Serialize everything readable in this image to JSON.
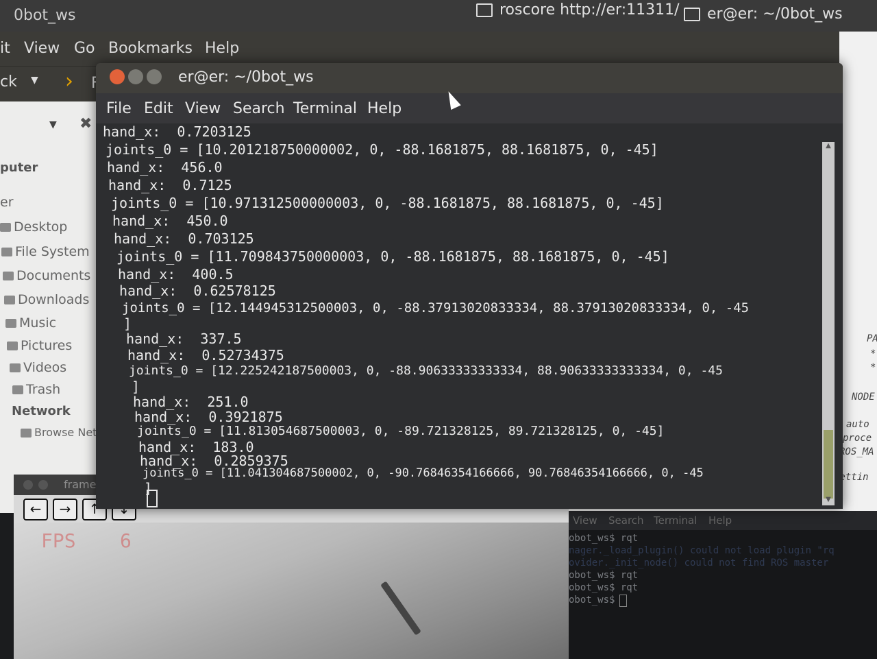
{
  "top_panel": {
    "app_title": "0bot_ws",
    "task_roscore": "roscore http://er:11311/",
    "task_terminal": "er@er: ~/0bot_ws"
  },
  "file_manager": {
    "menu": [
      "it",
      "View",
      "Go",
      "Bookmarks",
      "Help"
    ],
    "toolbar_back": "ck",
    "toolbar_f": "F",
    "sidebar_heading_computer": "puter",
    "sidebar_items": [
      {
        "label": "er",
        "icon": "home-icon"
      },
      {
        "label": "Desktop",
        "icon": "folder-icon"
      },
      {
        "label": "File System",
        "icon": "drive-icon"
      },
      {
        "label": "Documents",
        "icon": "folder-icon"
      },
      {
        "label": "Downloads",
        "icon": "folder-icon"
      },
      {
        "label": "Music",
        "icon": "music-icon"
      },
      {
        "label": "Pictures",
        "icon": "pictures-icon"
      },
      {
        "label": "Videos",
        "icon": "video-icon"
      },
      {
        "label": "Trash",
        "icon": "trash-icon"
      }
    ],
    "sidebar_heading_network": "Network",
    "sidebar_network_item": "Browse Netw..."
  },
  "terminal": {
    "title": "er@er: ~/0bot_ws",
    "menu": [
      "File",
      "Edit",
      "View",
      "Search",
      "Terminal",
      "Help"
    ],
    "lines": [
      "hand_x:  0.7203125",
      "joints_0 = [10.201218750000002, 0, -88.1681875, 88.1681875, 0, -45]",
      "hand_x:  456.0",
      "hand_x:  0.7125",
      "joints_0 = [10.971312500000003, 0, -88.1681875, 88.1681875, 0, -45]",
      "hand_x:  450.0",
      "hand_x:  0.703125",
      "joints_0 = [11.709843750000003, 0, -88.1681875, 88.1681875, 0, -45]",
      "hand_x:  400.5",
      "hand_x:  0.62578125",
      "joints_0 = [12.144945312500003, 0, -88.37913020833334, 88.37913020833334, 0, -45",
      "]",
      "hand_x:  337.5",
      "hand_x:  0.52734375",
      "joints_0 = [12.225242187500003, 0, -88.90633333333334, 88.90633333333334, 0, -45",
      "]",
      "hand_x:  251.0",
      "hand_x:  0.3921875",
      "joints_0 = [11.813054687500003, 0, -89.721328125, 89.721328125, 0, -45]",
      "hand_x:  183.0",
      "hand_x:  0.2859375",
      "joints_0 = [11.041304687500002, 0, -90.76846354166666, 90.76846354166666, 0, -45",
      "]"
    ]
  },
  "frame_window": {
    "title": "frame",
    "fps_label": "FPS",
    "fps_value": "6",
    "tools": [
      "←",
      "→",
      "↑",
      "↓"
    ]
  },
  "terminal2": {
    "menu": [
      "View",
      "Search",
      "Terminal",
      "Help"
    ],
    "lines": [
      "obot_ws$ rqt",
      "nager._load_plugin() could not load plugin \"rq",
      "ovider._init_node() could not find ROS master",
      "obot_ws$ rqt",
      "obot_ws$ rqt",
      "obot_ws$ "
    ]
  },
  "editor_edge": {
    "lines": [
      "PA",
      "*",
      "*",
      "NODE",
      "auto",
      "proce",
      "ROS_MA",
      "settin"
    ]
  }
}
